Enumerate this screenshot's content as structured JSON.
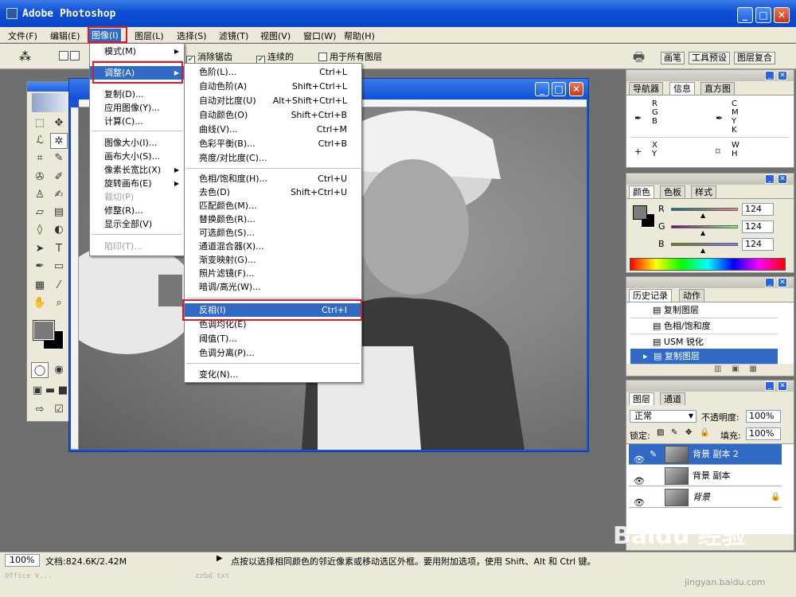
{
  "app": {
    "title": "Adobe Photoshop"
  },
  "menubar": [
    "文件(F)",
    "编辑(E)",
    "图像(I)",
    "图层(L)",
    "选择(S)",
    "滤镜(T)",
    "视图(V)",
    "窗口(W)",
    "帮助(H)"
  ],
  "options": {
    "antialias": "消除锯齿",
    "contiguous": "连续的",
    "all_layers": "用于所有图层",
    "tabs": [
      "画笔",
      "工具预设",
      "图层复合"
    ]
  },
  "image_menu": {
    "items": [
      "模式(M)",
      "调整(A)",
      "复制(D)...",
      "应用图像(Y)...",
      "计算(C)...",
      "图像大小(I)...",
      "画布大小(S)...",
      "像素长宽比(X)",
      "旋转画布(E)",
      "裁切(P)",
      "修整(R)...",
      "显示全部(V)",
      "陷印(T)..."
    ]
  },
  "adjust_menu": {
    "items": [
      {
        "label": "色阶(L)...",
        "shortcut": "Ctrl+L"
      },
      {
        "label": "自动色阶(A)",
        "shortcut": "Shift+Ctrl+L"
      },
      {
        "label": "自动对比度(U)",
        "shortcut": "Alt+Shift+Ctrl+L"
      },
      {
        "label": "自动颜色(O)",
        "shortcut": "Shift+Ctrl+B"
      },
      {
        "label": "曲线(V)...",
        "shortcut": "Ctrl+M"
      },
      {
        "label": "色彩平衡(B)...",
        "shortcut": "Ctrl+B"
      },
      {
        "label": "亮度/对比度(C)...",
        "shortcut": ""
      },
      {
        "label": "色相/饱和度(H)...",
        "shortcut": "Ctrl+U"
      },
      {
        "label": "去色(D)",
        "shortcut": "Shift+Ctrl+U"
      },
      {
        "label": "匹配颜色(M)...",
        "shortcut": ""
      },
      {
        "label": "替换颜色(R)...",
        "shortcut": ""
      },
      {
        "label": "可选颜色(S)...",
        "shortcut": ""
      },
      {
        "label": "通道混合器(X)...",
        "shortcut": ""
      },
      {
        "label": "渐变映射(G)...",
        "shortcut": ""
      },
      {
        "label": "照片滤镜(F)...",
        "shortcut": ""
      },
      {
        "label": "暗调/高光(W)...",
        "shortcut": ""
      },
      {
        "label": "反相(I)",
        "shortcut": "Ctrl+I"
      },
      {
        "label": "色调均化(E)",
        "shortcut": ""
      },
      {
        "label": "阈值(T)...",
        "shortcut": ""
      },
      {
        "label": "色调分离(P)...",
        "shortcut": ""
      },
      {
        "label": "变化(N)...",
        "shortcut": ""
      }
    ]
  },
  "navigator": {
    "tabs": [
      "导航器",
      "信息",
      "直方图"
    ],
    "rgb": "R\nG\nB\n:\n:\n:",
    "r_label": "R",
    "g_label": "G",
    "b_label": "B",
    "c_label": "C",
    "m_label": "M",
    "y_label": "Y",
    "k_label": "K",
    "x_label": "X",
    "yy_label": "Y",
    "w_label": "W",
    "h_label": "H"
  },
  "color_panel": {
    "tabs": [
      "颜色",
      "色板",
      "样式"
    ],
    "r": "124",
    "g": "124",
    "b": "124",
    "r_label": "R",
    "g_label": "G",
    "b_label": "B"
  },
  "history": {
    "tabs": [
      "历史记录",
      "动作"
    ],
    "items": [
      "复制图层",
      "色相/饱和度",
      "USM 锐化",
      "复制图层"
    ]
  },
  "layers": {
    "tabs": [
      "图层",
      "通道"
    ],
    "blend_mode": "正常",
    "opacity_label": "不透明度:",
    "opacity": "100%",
    "lock_label": "锁定:",
    "fill_label": "填充:",
    "fill": "100%",
    "items": [
      "背景 副本 2",
      "背景 副本",
      "背景"
    ]
  },
  "status": {
    "zoom": "100%",
    "doc": "文档:824.6K/2.42M",
    "hint": "点按以选择相同颜色的邻近像素或移动选区外框。要用附加选项，使用 Shift、Alt 和 Ctrl 键。"
  },
  "watermark": {
    "text": "Baidu 经验",
    "url": "jingyan.baidu.com"
  },
  "taskbar": {
    "left": "Office V...",
    "mid": "zzbd txt"
  },
  "colors": {
    "accent": "#316ac5",
    "highlight_red": "#d0202e",
    "titlebar": "#0d4fd6"
  }
}
